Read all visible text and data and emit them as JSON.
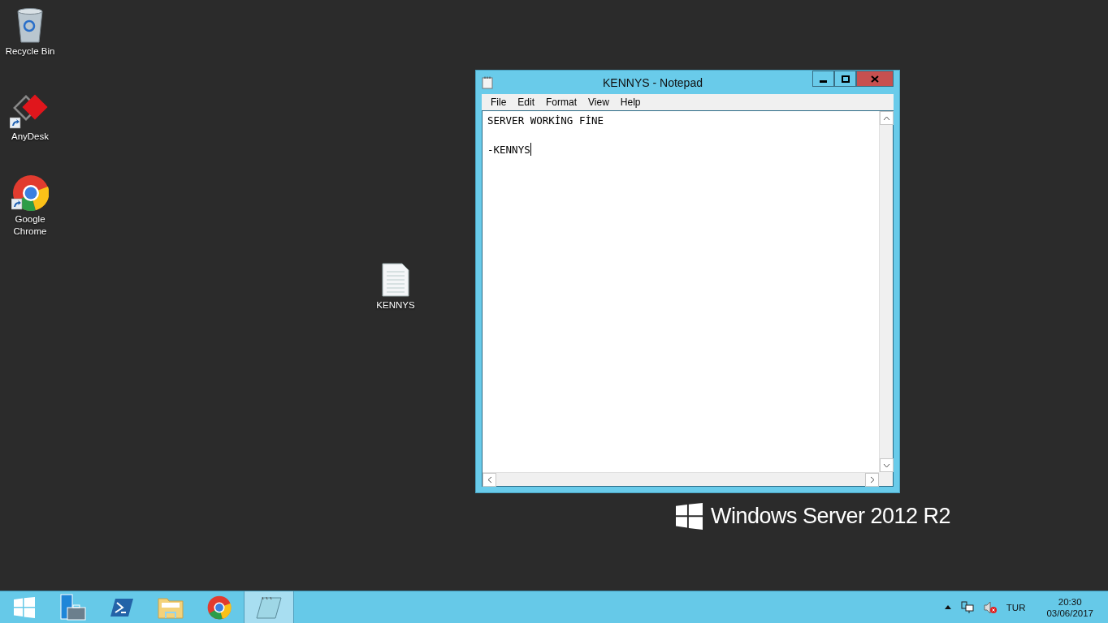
{
  "desktop": {
    "icons": [
      {
        "kind": "recycle",
        "label": "Recycle Bin",
        "shortcut": false
      },
      {
        "kind": "anydesk",
        "label": "AnyDesk",
        "shortcut": true
      },
      {
        "kind": "chrome",
        "label": "Google Chrome",
        "shortcut": true
      },
      {
        "kind": "textfile",
        "label": "KENNYS",
        "shortcut": false
      }
    ],
    "branding": "Windows Server 2012 R2"
  },
  "notepad": {
    "title": "KENNYS - Notepad",
    "menu": [
      "File",
      "Edit",
      "Format",
      "View",
      "Help"
    ],
    "content": "SERVER WORKİNG FİNE\n\n-KENNYS"
  },
  "taskbar": {
    "items": [
      {
        "kind": "start",
        "selected": false
      },
      {
        "kind": "server",
        "selected": false
      },
      {
        "kind": "powershell",
        "selected": false
      },
      {
        "kind": "explorer",
        "selected": false
      },
      {
        "kind": "chrome",
        "selected": false
      },
      {
        "kind": "notepad",
        "selected": true
      }
    ],
    "language": "TUR",
    "time": "20:30",
    "date": "03/06/2017"
  }
}
